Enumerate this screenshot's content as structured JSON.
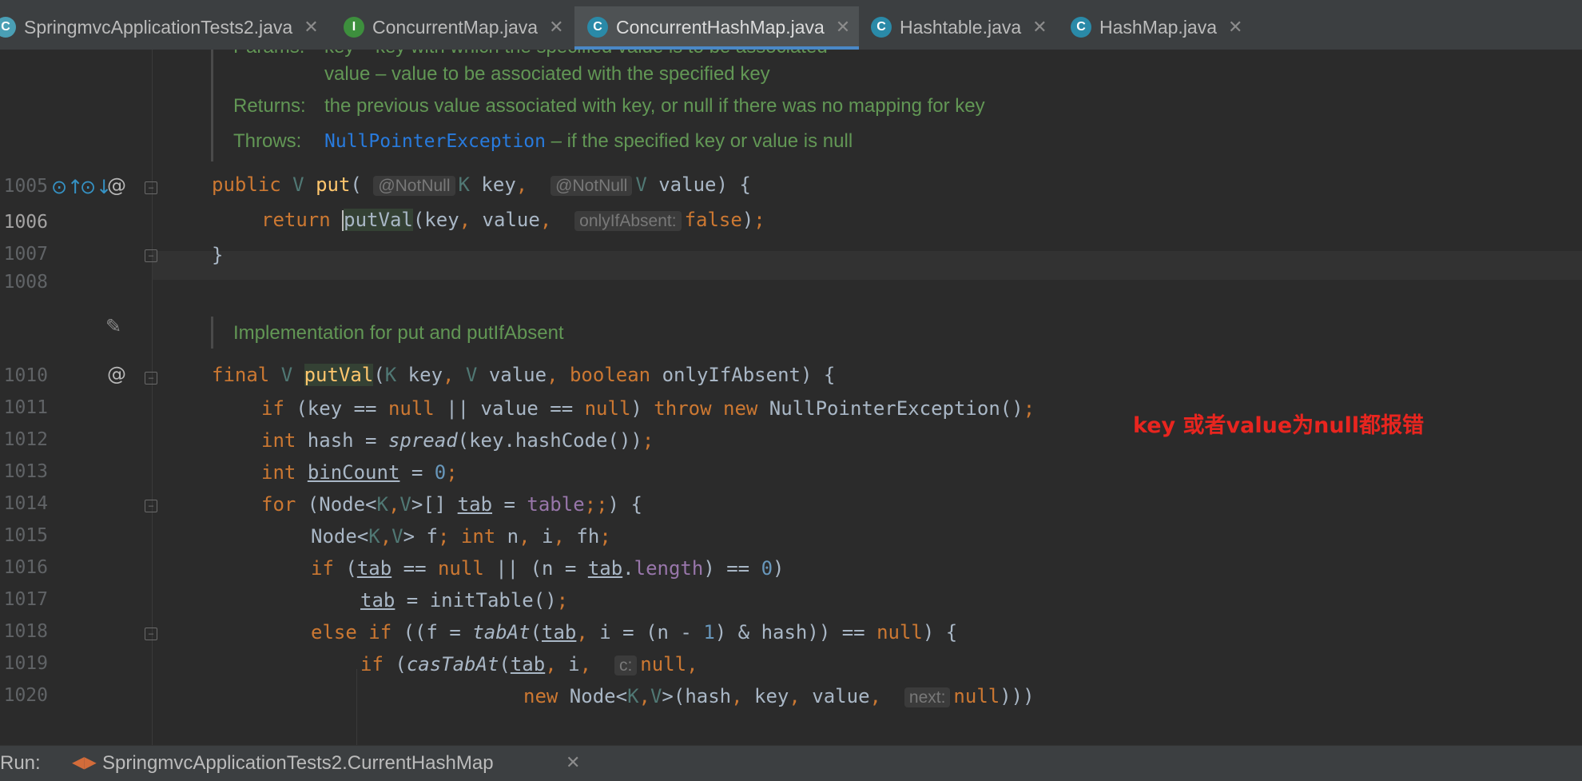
{
  "tabs": [
    {
      "icon": "C",
      "label": "SpringmvcApplicationTests2.java",
      "color": "#4a9fb5"
    },
    {
      "icon": "I",
      "label": "ConcurrentMap.java",
      "color": "#3d8f3d"
    },
    {
      "icon": "C",
      "label": "ConcurrentHashMap.java",
      "color": "#2a8aa8"
    },
    {
      "icon": "C",
      "label": "Hashtable.java",
      "color": "#2a8aa8"
    },
    {
      "icon": "C",
      "label": "HashMap.java",
      "color": "#2a8aa8"
    }
  ],
  "doc1": {
    "params_label": "Params:",
    "params_line1": "key – key with which the specified value is to be associated",
    "params_line2": "value – value to be associated with the specified key",
    "returns_label": "Returns:",
    "returns_text": "the previous value associated with key, or null if there was no mapping for key",
    "throws_label": "Throws:",
    "throws_link": "NullPointerException",
    "throws_text": " – if the specified key or value is null"
  },
  "doc2": "Implementation for put and putIfAbsent",
  "line_numbers": [
    "1005",
    "1006",
    "1007",
    "1008",
    "1010",
    "1011",
    "1012",
    "1013",
    "1014",
    "1015",
    "1016",
    "1017",
    "1018",
    "1019",
    "1020"
  ],
  "hints": {
    "notnull": "@NotNull",
    "onlyIfAbsent": "onlyIfAbsent:",
    "c": "c:",
    "next": "next:"
  },
  "annotation": "key 或者value为null都报错",
  "run": {
    "label": "Run:",
    "config": "SpringmvcApplicationTests2.CurrentHashMap"
  }
}
